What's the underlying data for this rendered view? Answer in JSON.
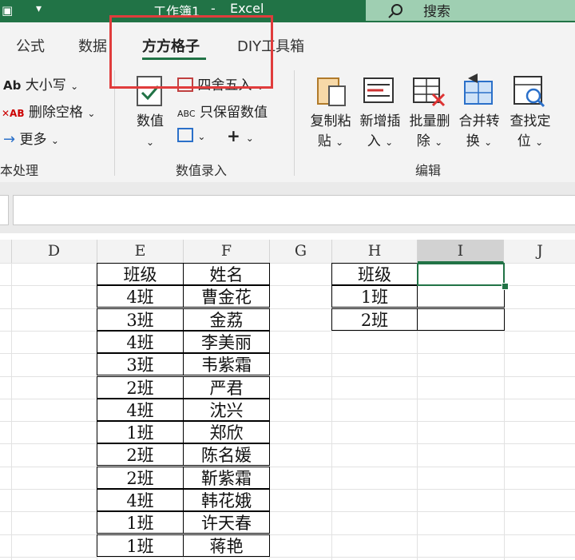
{
  "title_bar": {
    "file_name": "工作簿1",
    "separator": "-",
    "app_name": "Excel",
    "search_placeholder": "搜索"
  },
  "tabs": [
    {
      "label": "公式",
      "active": false
    },
    {
      "label": "数据",
      "active": false
    },
    {
      "label": "方方格子",
      "active": true
    },
    {
      "label": "DIY工具箱",
      "active": false
    }
  ],
  "ribbon": {
    "text_group": {
      "items": [
        {
          "icon": "Ab",
          "label": "大小写"
        },
        {
          "icon": "✕AB",
          "label": "删除空格"
        },
        {
          "icon": "arrow-right-icon",
          "label": "更多"
        }
      ],
      "group_label": "本处理"
    },
    "value_group": {
      "big_button": "数值",
      "items": [
        {
          "label": "四舍五入"
        },
        {
          "icon": "ABC",
          "label": "只保留数值"
        },
        {
          "label": "+"
        }
      ],
      "group_label": "数值录入"
    },
    "edit_group": {
      "buttons": [
        {
          "line1": "复制粘",
          "line2": "贴"
        },
        {
          "line1": "新增插",
          "line2": "入"
        },
        {
          "line1": "批量删",
          "line2": "除"
        },
        {
          "line1": "合并转",
          "line2": "换"
        },
        {
          "line1": "查找定",
          "line2": "位"
        }
      ],
      "group_label": "编辑"
    }
  },
  "columns": [
    "D",
    "E",
    "F",
    "G",
    "H",
    "I",
    "J"
  ],
  "table_main": {
    "headers": [
      "班级",
      "姓名"
    ],
    "rows": [
      [
        "4班",
        "曹金花"
      ],
      [
        "3班",
        "金荔"
      ],
      [
        "4班",
        "李美丽"
      ],
      [
        "3班",
        "韦紫霜"
      ],
      [
        "2班",
        "严君"
      ],
      [
        "4班",
        "沈兴"
      ],
      [
        "1班",
        "郑欣"
      ],
      [
        "2班",
        "陈名媛"
      ],
      [
        "2班",
        "靳紫霜"
      ],
      [
        "4班",
        "韩花娥"
      ],
      [
        "1班",
        "许天春"
      ],
      [
        "1班",
        "蒋艳"
      ]
    ]
  },
  "table_side": {
    "header": "班级",
    "rows": [
      "1班",
      "2班"
    ]
  },
  "colors": {
    "title_bar": "#217346",
    "highlight": "#e03c3c",
    "selection": "#217346"
  }
}
